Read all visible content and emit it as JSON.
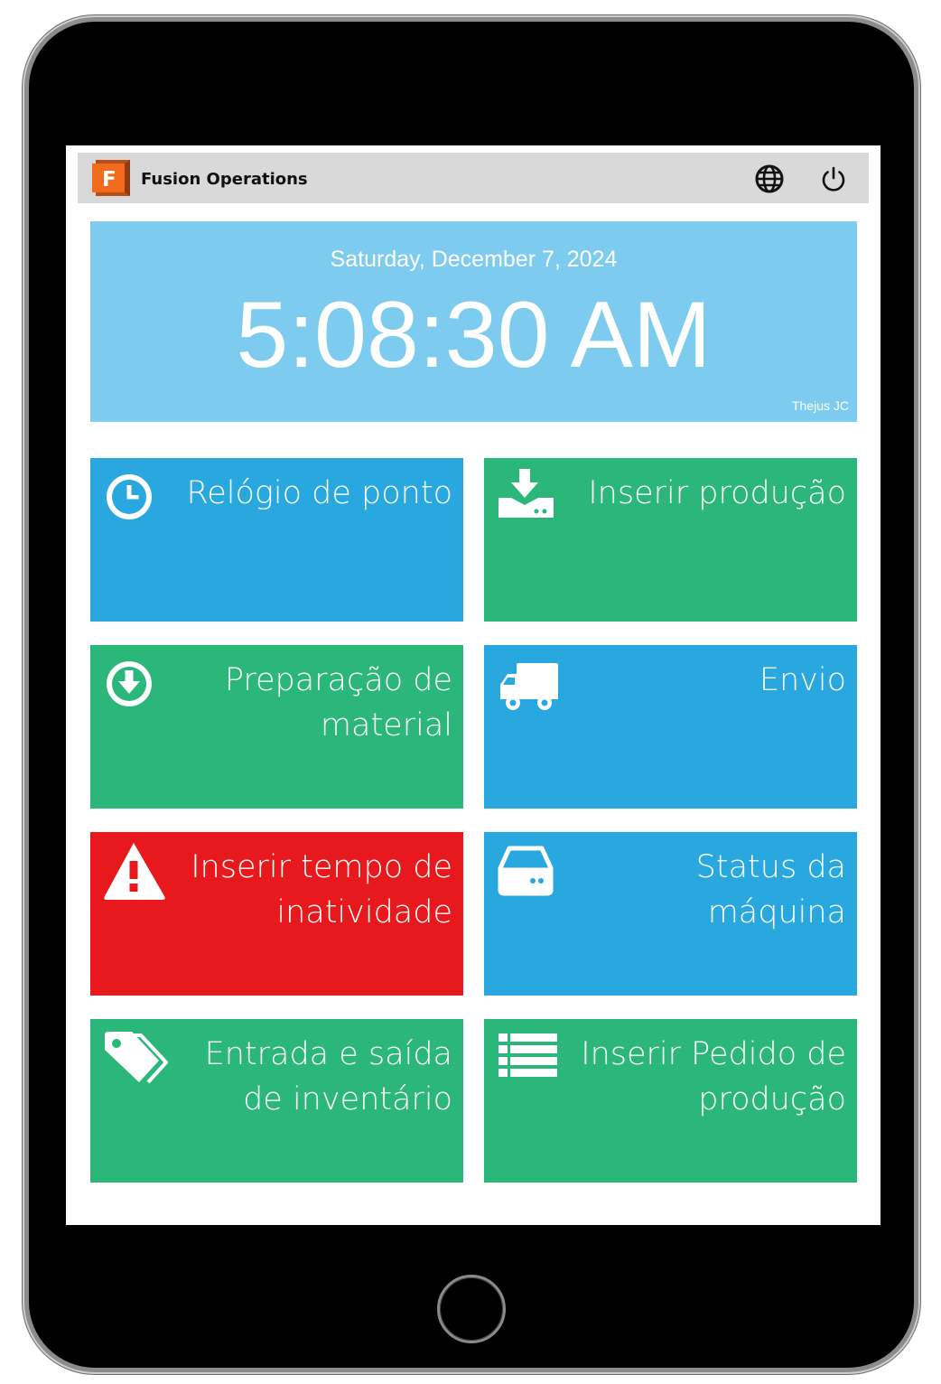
{
  "app": {
    "title": "Fusion Operations",
    "logo_letter": "F"
  },
  "header_icons": {
    "language": "globe-icon",
    "power": "power-icon"
  },
  "clock": {
    "date": "Saturday, December 7, 2024",
    "time": "5:08:30 AM",
    "credit": "Thejus JC"
  },
  "tiles": [
    {
      "label": "Relógio de ponto",
      "icon": "clock-icon",
      "color": "#29a8e0"
    },
    {
      "label": "Inserir produção",
      "icon": "download-tray-icon",
      "color": "#2bb77a"
    },
    {
      "label": "Preparação de material",
      "icon": "arrow-down-circle-icon",
      "color": "#2bb77a"
    },
    {
      "label": "Envio",
      "icon": "truck-icon",
      "color": "#29a8e0"
    },
    {
      "label": "Inserir tempo de inatividade",
      "icon": "warning-icon",
      "color": "#e8191c"
    },
    {
      "label": "Status da máquina",
      "icon": "hard-drive-icon",
      "color": "#29a8e0"
    },
    {
      "label": "Entrada e saída de inventário",
      "icon": "tags-icon",
      "color": "#2bb77a"
    },
    {
      "label": "Inserir Pedido de produção",
      "icon": "list-icon",
      "color": "#2bb77a"
    }
  ],
  "colors": {
    "clock_panel": "#7ecbf0",
    "blue_tile": "#29a8e0",
    "green_tile": "#2bb77a",
    "red_tile": "#e8191c",
    "app_bar": "#d9d9d9",
    "logo_orange": "#f26a1b"
  }
}
